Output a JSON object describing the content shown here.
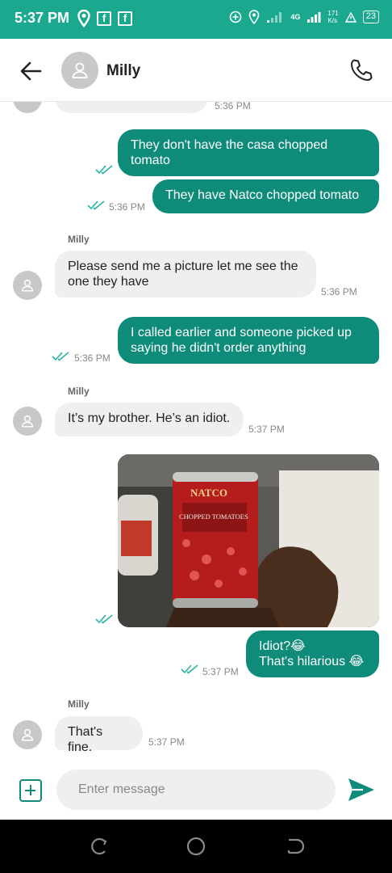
{
  "status_bar": {
    "time": "5:37 PM",
    "network": "4G",
    "speed_value": "171",
    "speed_unit": "K/s",
    "battery": "23"
  },
  "header": {
    "contact_name": "Milly"
  },
  "messages": [
    {
      "id": "m1",
      "direction": "outgoing",
      "text": "They don't have the casa chopped tomato",
      "time": ""
    },
    {
      "id": "m2",
      "direction": "outgoing",
      "text": "They have Natco chopped tomato",
      "time": "5:36 PM"
    },
    {
      "id": "m3",
      "direction": "incoming",
      "sender": "Milly",
      "text": "Please send me a picture let me see the one they have",
      "time": "5:36 PM"
    },
    {
      "id": "m4",
      "direction": "outgoing",
      "text": "I called earlier and someone picked up saying he didn't order anything",
      "time": "5:36 PM"
    },
    {
      "id": "m5",
      "direction": "incoming",
      "sender": "Milly",
      "text": "It’s my brother. He’s an idiot.",
      "time": "5:37 PM"
    },
    {
      "id": "m6",
      "direction": "outgoing",
      "type": "image",
      "image_text": {
        "brand": "NATCO",
        "product": "CHOPPED TOMATOES"
      },
      "time": ""
    },
    {
      "id": "m7",
      "direction": "outgoing",
      "text_line1": "Idiot?😂",
      "text_line2": "That's hilarious 😂",
      "time": "5:37 PM"
    },
    {
      "id": "m8",
      "direction": "incoming",
      "sender": "Milly",
      "text": "That's fine.",
      "time": "5:37 PM"
    }
  ],
  "top_partial_message": {
    "time": "5:36 PM"
  },
  "compose": {
    "placeholder": "Enter message"
  },
  "colors": {
    "status_bar": "#1aa98f",
    "outgoing_bubble": "#0e8c79",
    "incoming_bubble": "#efefef",
    "ticks": "#2bb3a3"
  },
  "icons": {
    "back": "arrow-left-icon",
    "call": "phone-icon",
    "attach": "plus-square-icon",
    "send": "send-icon",
    "read": "double-check-icon"
  }
}
